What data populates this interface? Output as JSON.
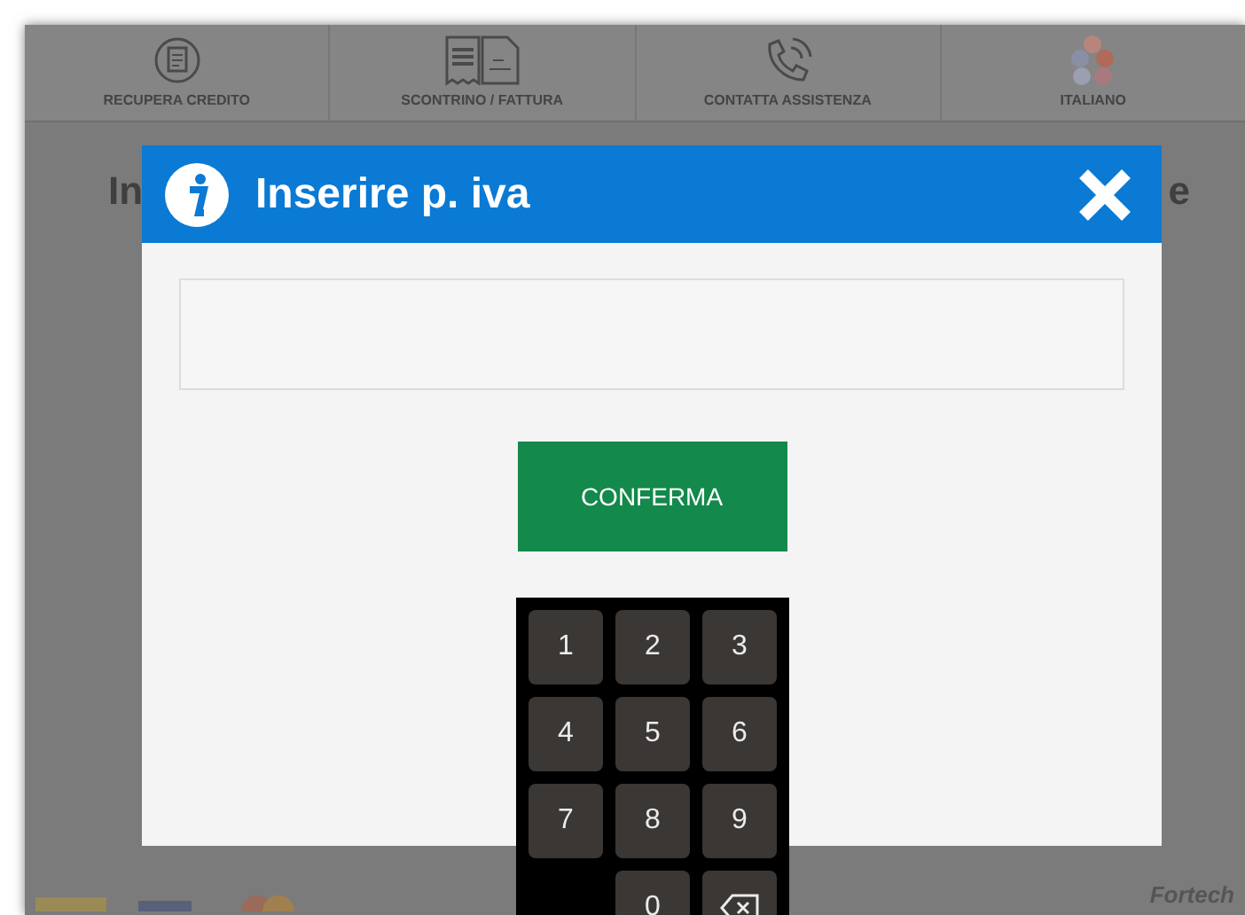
{
  "nav": [
    {
      "label": "RECUPERA CREDITO",
      "kind": "credit"
    },
    {
      "label": "SCONTRINO / FATTURA",
      "kind": "receipt"
    },
    {
      "label": "CONTATTA ASSISTENZA",
      "kind": "phone"
    },
    {
      "label": "ITALIANO",
      "kind": "flags"
    }
  ],
  "background_heading": {
    "left": "In",
    "right": "e"
  },
  "dialog": {
    "title": "Inserire p. iva",
    "confirm": "CONFERMA"
  },
  "keypad": {
    "keys": [
      {
        "label": "1",
        "kind": "digit"
      },
      {
        "label": "2",
        "kind": "digit"
      },
      {
        "label": "3",
        "kind": "digit"
      },
      {
        "label": "4",
        "kind": "digit"
      },
      {
        "label": "5",
        "kind": "digit"
      },
      {
        "label": "6",
        "kind": "digit"
      },
      {
        "label": "7",
        "kind": "digit"
      },
      {
        "label": "8",
        "kind": "digit"
      },
      {
        "label": "9",
        "kind": "digit"
      },
      {
        "kind": "blank"
      },
      {
        "label": "0",
        "kind": "digit"
      },
      {
        "kind": "backspace"
      }
    ]
  },
  "footer": {
    "brand": "Fortech"
  }
}
